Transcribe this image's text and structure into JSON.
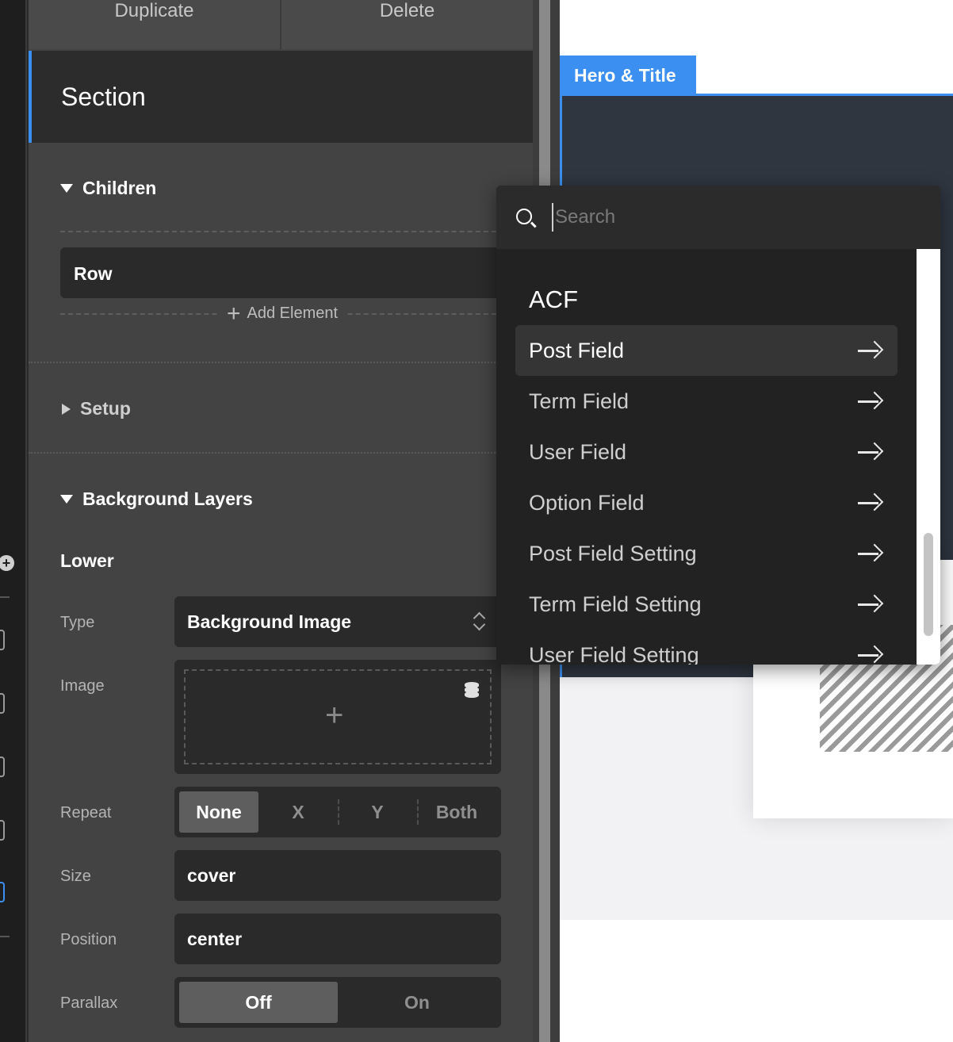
{
  "toolbar": {
    "duplicate_label": "Duplicate",
    "delete_label": "Delete"
  },
  "section": {
    "title": "Section"
  },
  "children": {
    "title": "Children",
    "row_label": "Row",
    "add_element_label": "Add Element"
  },
  "setup": {
    "title": "Setup"
  },
  "background_layers": {
    "title": "Background Layers",
    "layer_title": "Lower",
    "type": {
      "label": "Type",
      "value": "Background Image"
    },
    "image": {
      "label": "Image",
      "add_symbol": "+"
    },
    "repeat": {
      "label": "Repeat",
      "options": [
        "None",
        "X",
        "Y",
        "Both"
      ],
      "selected": "None"
    },
    "size": {
      "label": "Size",
      "value": "cover"
    },
    "position": {
      "label": "Position",
      "value": "center"
    },
    "parallax": {
      "label": "Parallax",
      "options": [
        "Off",
        "On"
      ],
      "selected": "Off"
    }
  },
  "canvas": {
    "tab_label": "Hero & Title"
  },
  "dropdown": {
    "search_placeholder": "Search",
    "category": "ACF",
    "items": [
      "Post Field",
      "Term Field",
      "User Field",
      "Option Field",
      "Post Field Setting",
      "Term Field Setting",
      "User Field Setting"
    ],
    "highlighted": "Post Field"
  },
  "colors": {
    "accent": "#3b8ff0",
    "panel": "#434343",
    "dark": "#2a2a2a"
  }
}
